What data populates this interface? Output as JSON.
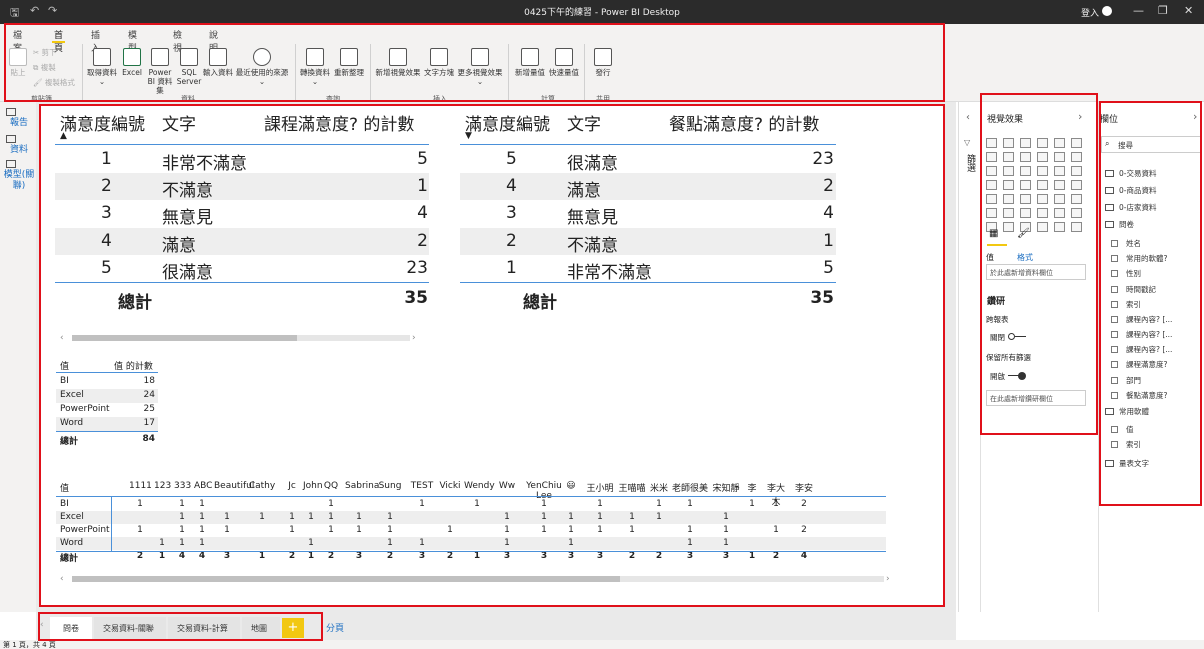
{
  "window": {
    "title": "0425下午的練習 - Power BI Desktop",
    "login": "登入"
  },
  "ribbon": {
    "tabs": [
      "檔案",
      "首頁",
      "插入",
      "模型化",
      "檢視",
      "說明"
    ],
    "clipboard": {
      "paste": "貼上",
      "cut": "剪下",
      "copy": "複製",
      "format_painter": "複製格式",
      "group": "剪貼簿"
    },
    "data": {
      "get_data": "取得資料",
      "excel": "Excel",
      "pbi_dataset": "Power BI 資料集",
      "sql": "SQL Server",
      "enter_data": "輸入資料",
      "recent": "最近使用的來源",
      "group": "資料"
    },
    "queries": {
      "transform": "轉換資料",
      "refresh": "重新整理",
      "group": "查詢"
    },
    "insert": {
      "new_visual": "新增視覺效果",
      "text_box": "文字方塊",
      "more_visuals": "更多視覺效果",
      "group": "插入"
    },
    "calc": {
      "new_measure": "新增量值",
      "quick_measure": "快速量值",
      "group": "計算"
    },
    "share": {
      "publish": "發行",
      "group": "共用"
    }
  },
  "left_nav": {
    "report": "報告",
    "data": "資料",
    "model": "模型(關聯)"
  },
  "matrix1": {
    "headers": [
      "滿意度編號",
      "文字",
      "課程滿意度? 的計數"
    ],
    "rows": [
      [
        "1",
        "非常不滿意",
        "5"
      ],
      [
        "2",
        "不滿意",
        "1"
      ],
      [
        "3",
        "無意見",
        "4"
      ],
      [
        "4",
        "滿意",
        "2"
      ],
      [
        "5",
        "很滿意",
        "23"
      ]
    ],
    "total": [
      "總計",
      "35"
    ]
  },
  "matrix2": {
    "headers": [
      "滿意度編號",
      "文字",
      "餐點滿意度? 的計數"
    ],
    "rows": [
      [
        "5",
        "很滿意",
        "23"
      ],
      [
        "4",
        "滿意",
        "2"
      ],
      [
        "3",
        "無意見",
        "4"
      ],
      [
        "2",
        "不滿意",
        "1"
      ],
      [
        "1",
        "非常不滿意",
        "5"
      ]
    ],
    "total": [
      "總計",
      "35"
    ]
  },
  "table3": {
    "headers": [
      "值",
      "值 的計數"
    ],
    "rows": [
      [
        "BI",
        "18"
      ],
      [
        "Excel",
        "24"
      ],
      [
        "PowerPoint",
        "25"
      ],
      [
        "Word",
        "17"
      ]
    ],
    "total": [
      "總計",
      "84"
    ]
  },
  "matrix4": {
    "corner": "值",
    "columns": [
      "1111",
      "123",
      "333",
      "ABC",
      "Beautiful",
      "Cathy",
      "Jc",
      "John",
      "QQ",
      "Sabrina",
      "Sung",
      "TEST",
      "Vicki",
      "Wendy",
      "Ww",
      "YenChiu Lee",
      "😃",
      "王小明",
      "王喵喵",
      "米米",
      "老師很美",
      "宋知靜",
      "李",
      "李大大",
      "李安"
    ],
    "rows": [
      {
        "label": "BI",
        "cells": [
          "1",
          "",
          "1",
          "1",
          "",
          "",
          "",
          "",
          "1",
          "",
          "",
          "1",
          "",
          "1",
          "",
          "1",
          "",
          "1",
          "",
          "1",
          "1",
          "",
          "1",
          "1",
          "2"
        ]
      },
      {
        "label": "Excel",
        "cells": [
          "",
          "",
          "1",
          "1",
          "1",
          "1",
          "1",
          "1",
          "1",
          "1",
          "1",
          "",
          "",
          "",
          "1",
          "1",
          "1",
          "1",
          "1",
          "1",
          "",
          "1",
          "",
          "",
          ""
        ]
      },
      {
        "label": "PowerPoint",
        "cells": [
          "1",
          "",
          "1",
          "1",
          "1",
          "",
          "1",
          "",
          "1",
          "1",
          "1",
          "",
          "1",
          "",
          "1",
          "1",
          "1",
          "1",
          "1",
          "",
          "1",
          "1",
          "",
          "1",
          "2"
        ]
      },
      {
        "label": "Word",
        "cells": [
          "",
          "1",
          "1",
          "1",
          "",
          "",
          "",
          "1",
          "",
          "",
          "1",
          "1",
          "",
          "",
          "1",
          "",
          "1",
          "",
          "",
          "",
          "1",
          "1",
          "",
          "",
          ""
        ]
      },
      {
        "label": "總計",
        "cells": [
          "2",
          "1",
          "4",
          "4",
          "3",
          "1",
          "2",
          "1",
          "2",
          "3",
          "2",
          "3",
          "2",
          "1",
          "3",
          "3",
          "3",
          "3",
          "2",
          "2",
          "3",
          "3",
          "1",
          "2",
          "4"
        ]
      }
    ]
  },
  "visualizations": {
    "title": "視覺效果",
    "tab_values": "值",
    "tab_format": "格式",
    "values_well": "於此處新增資料欄位",
    "drill": "鑽研",
    "cross_report": "跨報表",
    "off": "關閉",
    "keep_filters": "保留所有篩選",
    "on": "開啟",
    "drill_well": "在此處新增鑽研欄位",
    "filters_label": "篩選"
  },
  "fields": {
    "title": "欄位",
    "search": "搜尋",
    "items": [
      {
        "type": "table",
        "label": "0-交易資料"
      },
      {
        "type": "table",
        "label": "0-商品資料"
      },
      {
        "type": "table",
        "label": "0-店家資料"
      },
      {
        "type": "table",
        "label": "問卷"
      },
      {
        "type": "field",
        "label": "姓名"
      },
      {
        "type": "field",
        "label": "常用的軟體?"
      },
      {
        "type": "field",
        "label": "性別"
      },
      {
        "type": "field",
        "label": "時間戳記"
      },
      {
        "type": "field",
        "label": "索引"
      },
      {
        "type": "field",
        "label": "課程內容? [..."
      },
      {
        "type": "field",
        "label": "課程內容? [..."
      },
      {
        "type": "field",
        "label": "課程內容? [..."
      },
      {
        "type": "field",
        "label": "課程滿意度?"
      },
      {
        "type": "field",
        "label": "部門"
      },
      {
        "type": "field",
        "label": "餐點滿意度?"
      },
      {
        "type": "table",
        "label": "常用軟體"
      },
      {
        "type": "field",
        "label": "值"
      },
      {
        "type": "field",
        "label": "索引"
      },
      {
        "type": "table",
        "label": "量表文字"
      }
    ]
  },
  "pages": {
    "tabs": [
      "問卷",
      "交易資料-關聯",
      "交易資料-計算",
      "地圖"
    ],
    "add": "+",
    "label": "分頁"
  },
  "status": {
    "text": "第 1 頁，共 4 頁"
  }
}
